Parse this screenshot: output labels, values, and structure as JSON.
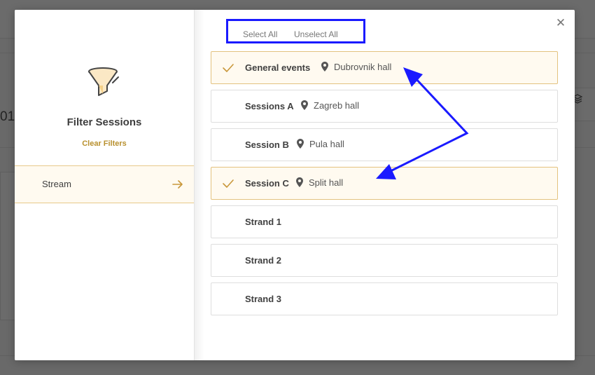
{
  "background": {
    "partial_text": "01"
  },
  "modal": {
    "sidebar": {
      "title": "Filter Sessions",
      "clear_label": "Clear Filters",
      "items": [
        {
          "label": "Stream",
          "active": true
        }
      ]
    },
    "actions": {
      "select_all": "Select All",
      "unselect_all": "Unselect All"
    },
    "sessions": [
      {
        "name": "General events",
        "location": "Dubrovnik hall",
        "selected": true
      },
      {
        "name": "Sessions A",
        "location": "Zagreb hall",
        "selected": false
      },
      {
        "name": "Session B",
        "location": "Pula hall",
        "selected": false
      },
      {
        "name": "Session C",
        "location": "Split hall",
        "selected": true
      },
      {
        "name": "Strand 1",
        "location": "",
        "selected": false
      },
      {
        "name": "Strand 2",
        "location": "",
        "selected": false
      },
      {
        "name": "Strand 3",
        "location": "",
        "selected": false
      }
    ]
  },
  "colors": {
    "accent": "#b8902e",
    "selected_bg": "#fffaf0",
    "selected_border": "#e3c27f",
    "annotation": "#1a1aff"
  },
  "icons": {
    "filter": "funnel-icon",
    "close": "close-icon",
    "check": "check-icon",
    "location": "map-pin-icon",
    "stream_arrow": "arrow-right-icon"
  }
}
